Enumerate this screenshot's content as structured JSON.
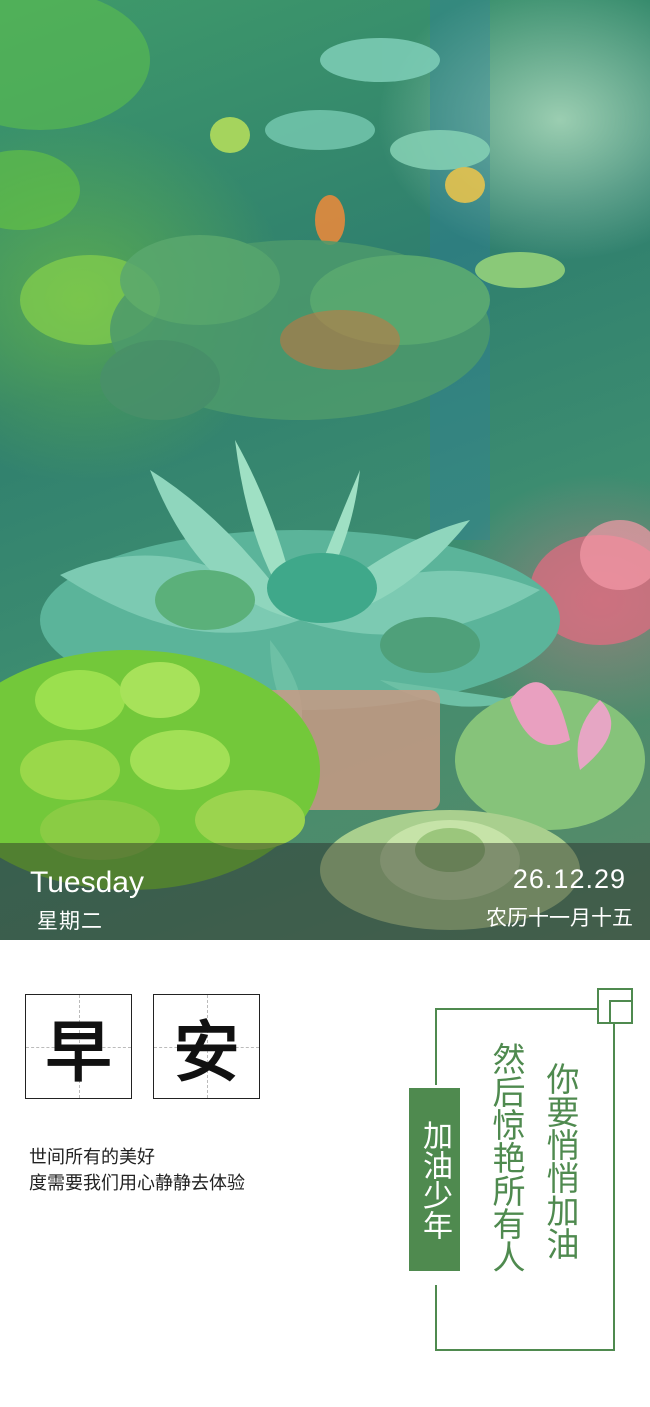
{
  "hero": {
    "weekday_en": "Tuesday",
    "weekday_cn": "星期二",
    "date": "26.12.29",
    "lunar_date": "农历十一月十五"
  },
  "greeting": {
    "char1": "早",
    "char2": "安",
    "quote_line1": "世间所有的美好",
    "quote_line2": "度需要我们用心静静去体验"
  },
  "poem": {
    "tag": "加油少年",
    "line1": "你要悄悄加油",
    "line2": "然后惊艳所有人"
  },
  "colors": {
    "accent_green": "#4f8a4f"
  }
}
